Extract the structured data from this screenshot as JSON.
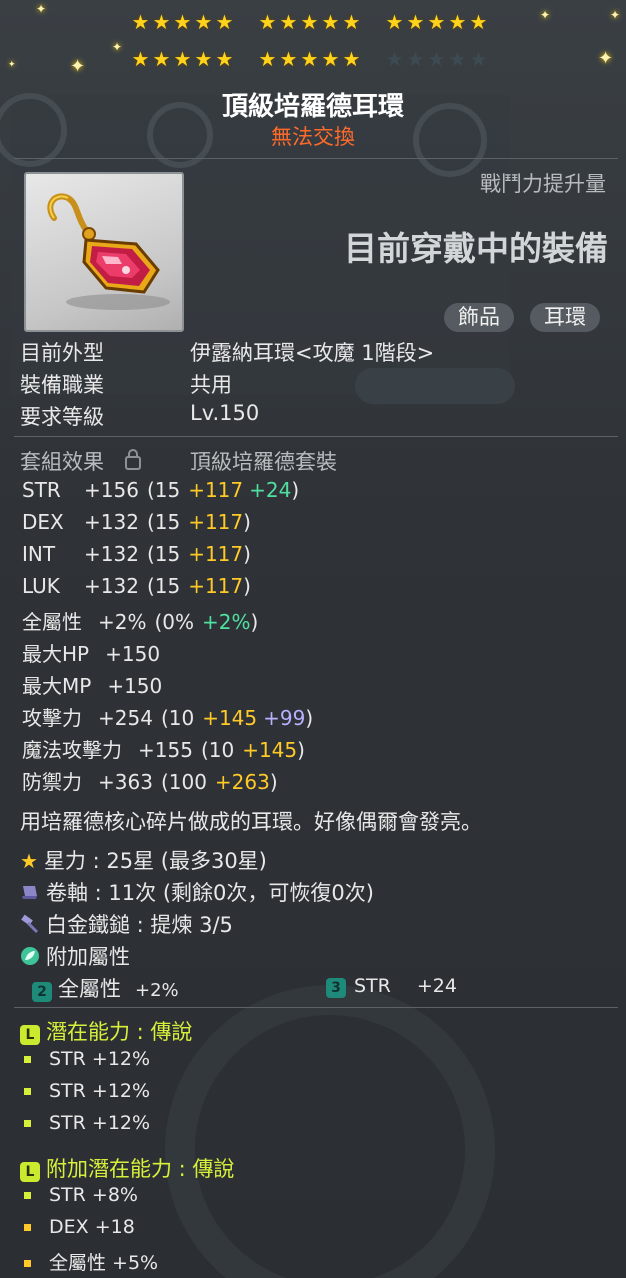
{
  "header": {
    "stars": {
      "row1": 15,
      "row2_filled": 10,
      "row2_empty": 5
    },
    "title": "頂級培羅德耳環",
    "tradeability": "無法交換"
  },
  "item_icon": "pink-gem-earring-icon",
  "power": {
    "label": "戰鬥力提升量",
    "status": "目前穿戴中的裝備"
  },
  "tags": [
    "飾品",
    "耳環"
  ],
  "info": [
    {
      "label": "目前外型",
      "value": "伊露納耳環<攻魔 1階段>"
    },
    {
      "label": "裝備職業",
      "value": "共用"
    },
    {
      "label": "要求等級",
      "value": "Lv.150"
    }
  ],
  "set": {
    "label": "套組效果",
    "value": "頂級培羅德套裝",
    "icon": "lock-icon"
  },
  "stats": [
    {
      "name": "STR",
      "total": "+156",
      "base": "(15",
      "bonus1": "+117",
      "bonus2": "+24",
      "close": ")",
      "c1": "y",
      "c2": "g"
    },
    {
      "name": "DEX",
      "total": "+132",
      "base": "(15",
      "bonus1": "+117",
      "close": ")",
      "c1": "y"
    },
    {
      "name": "INT",
      "total": "+132",
      "base": "(15",
      "bonus1": "+117",
      "close": ")",
      "c1": "y"
    },
    {
      "name": "LUK",
      "total": "+132",
      "base": "(15",
      "bonus1": "+117",
      "close": ")",
      "c1": "y"
    },
    {
      "name": "全屬性",
      "total": "+2%",
      "base": "(0%",
      "bonus1": "+2%",
      "close": ")",
      "c1": "g"
    },
    {
      "name": "最大HP",
      "total": "+150"
    },
    {
      "name": "最大MP",
      "total": "+150"
    },
    {
      "name": "攻擊力",
      "total": "+254",
      "base": "(10",
      "bonus1": "+145",
      "bonus2": "+99",
      "close": ")",
      "c1": "y",
      "c2": "p"
    },
    {
      "name": "魔法攻擊力",
      "total": "+155",
      "base": "(10",
      "bonus1": "+145",
      "close": ")",
      "c1": "y"
    },
    {
      "name": "防禦力",
      "total": "+363",
      "base": "(100",
      "bonus1": "+263",
      "close": ")",
      "c1": "y"
    }
  ],
  "description": "用培羅德核心碎片做成的耳環。好像偶爾會發亮。",
  "upgrades": [
    {
      "icon": "star-icon",
      "text": "星力 : 25星 (最多30星)"
    },
    {
      "icon": "scroll-icon",
      "text": "卷軸 : 11次 (剩餘0次，可恢復0次)"
    },
    {
      "icon": "hammer-icon",
      "text": "白金鐵鎚 : 提煉 3/5"
    },
    {
      "icon": "leaf-icon",
      "text": "附加屬性"
    }
  ],
  "flames": [
    {
      "grade": "2",
      "text": "全屬性",
      "value": "+2%"
    },
    {
      "grade": "3",
      "text": "STR",
      "value": "+24"
    }
  ],
  "potential": {
    "badge": "L",
    "title": "潛在能力 : 傳說",
    "lines": [
      "STR +12%",
      "STR +12%",
      "STR +12%"
    ]
  },
  "bonus_potential": {
    "badge": "L",
    "title": "附加潛在能力 : 傳說",
    "lines": [
      "STR +8%",
      "DEX +18",
      "全屬性 +5%"
    ]
  },
  "colors": {
    "gold": "#ffc928",
    "green": "#4fe0a0",
    "purple": "#b9b0ff",
    "legendary": "#d8f03a",
    "untradeable": "#ff6a2a"
  }
}
